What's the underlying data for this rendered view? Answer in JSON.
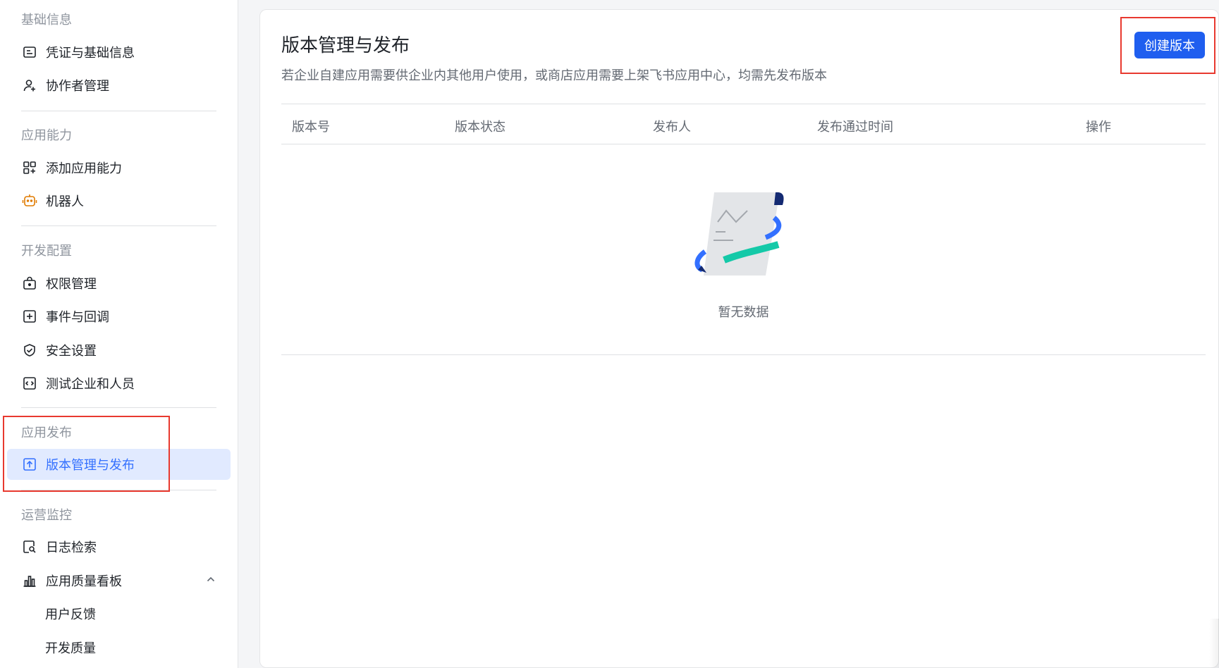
{
  "sidebar": {
    "groups": [
      {
        "title": "基础信息",
        "items": [
          {
            "label": "凭证与基础信息",
            "icon": "credential-icon"
          },
          {
            "label": "协作者管理",
            "icon": "user-add-icon"
          }
        ]
      },
      {
        "title": "应用能力",
        "items": [
          {
            "label": "添加应用能力",
            "icon": "apps-add-icon"
          },
          {
            "label": "机器人",
            "icon": "robot-icon"
          }
        ]
      },
      {
        "title": "开发配置",
        "items": [
          {
            "label": "权限管理",
            "icon": "lock-icon"
          },
          {
            "label": "事件与回调",
            "icon": "event-icon"
          },
          {
            "label": "安全设置",
            "icon": "shield-icon"
          },
          {
            "label": "测试企业和人员",
            "icon": "code-icon"
          }
        ]
      },
      {
        "title": "应用发布",
        "items": [
          {
            "label": "版本管理与发布",
            "icon": "upload-icon",
            "active": true
          }
        ]
      },
      {
        "title": "运营监控",
        "items": [
          {
            "label": "日志检索",
            "icon": "log-search-icon"
          },
          {
            "label": "应用质量看板",
            "icon": "bar-chart-icon",
            "expanded": true
          },
          {
            "label": "用户反馈"
          },
          {
            "label": "开发质量"
          }
        ]
      }
    ]
  },
  "main": {
    "title": "版本管理与发布",
    "description": "若企业自建应用需要供企业内其他用户使用，或商店应用需要上架飞书应用中心，均需先发布版本",
    "create_button": "创建版本",
    "table": {
      "columns": [
        "版本号",
        "版本状态",
        "发布人",
        "发布通过时间",
        "操作"
      ],
      "rows": []
    },
    "empty_text": "暂无数据"
  },
  "colors": {
    "accent": "#3370ff",
    "button": "#1f5eef",
    "active_bg": "#e1eaff",
    "highlight_box": "#e8392f",
    "robot_icon": "#e07b00"
  }
}
